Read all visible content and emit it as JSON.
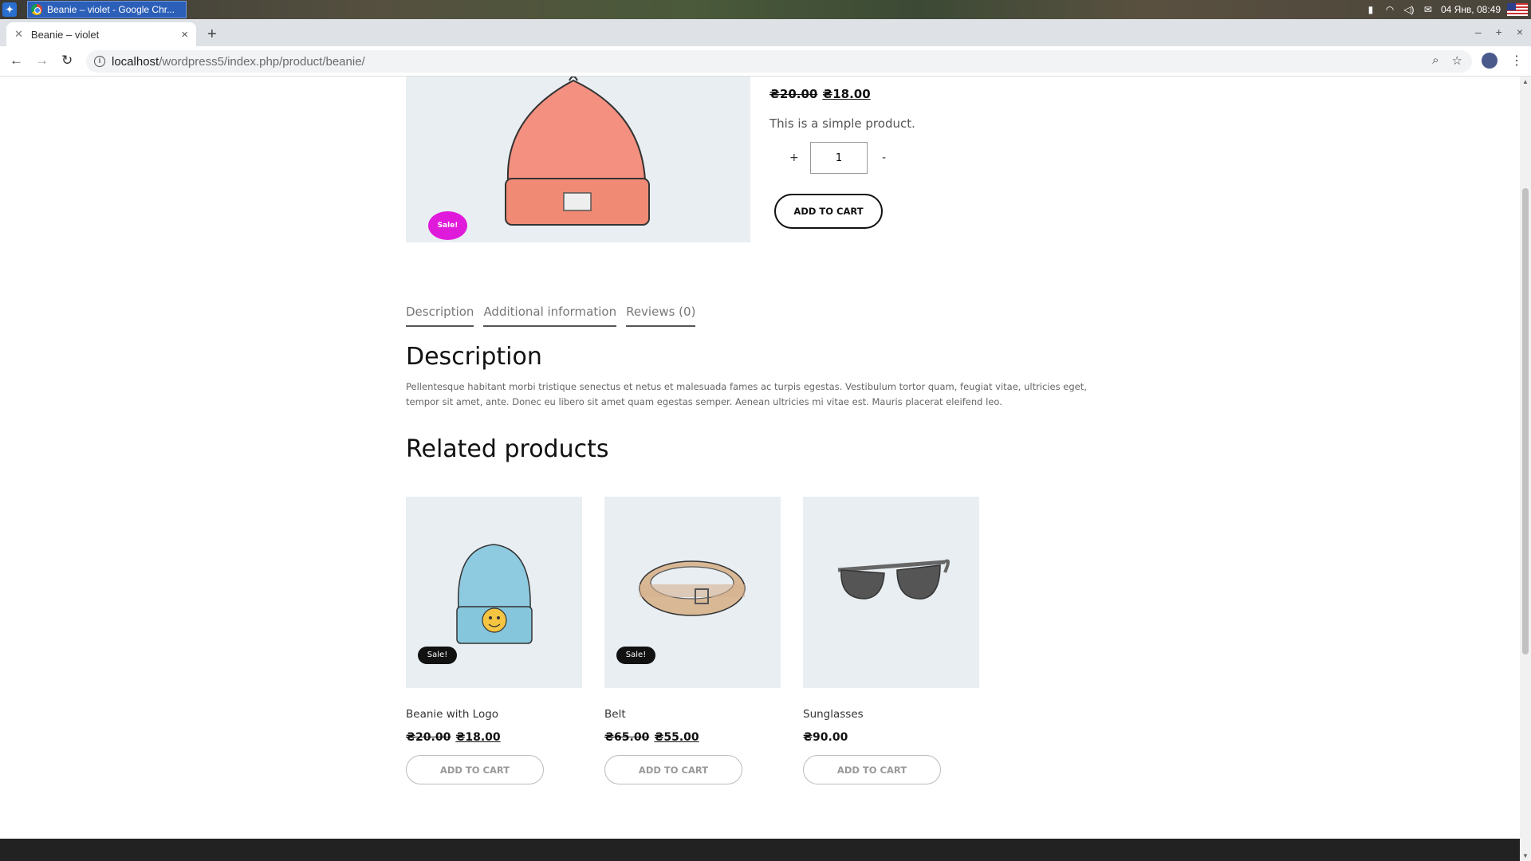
{
  "taskbar": {
    "app_label": "Beanie – violet - Google Chr...",
    "datetime": "04 Янв, 08:49"
  },
  "browser": {
    "tab_title": "Beanie – violet",
    "url_host": "localhost",
    "url_path": "/wordpress5/index.php/product/beanie/"
  },
  "product": {
    "old_price": "₴20.00",
    "new_price": "₴18.00",
    "short_description": "This is a simple product.",
    "qty_plus": "+",
    "quantity": "1",
    "qty_minus": "-",
    "add_to_cart": "ADD TO CART",
    "sale_badge": "Sale!",
    "image_color": "#f28b74"
  },
  "tabs": [
    {
      "label": "Description"
    },
    {
      "label": "Additional information"
    },
    {
      "label": "Reviews (0)"
    }
  ],
  "description": {
    "heading": "Description",
    "text": "Pellentesque habitant morbi tristique senectus et netus et malesuada fames ac turpis egestas. Vestibulum tortor quam, feugiat vitae, ultricies eget, tempor sit amet, ante. Donec eu libero sit amet quam egestas semper. Aenean ultricies mi vitae est. Mauris placerat eleifend leo."
  },
  "related": {
    "heading": "Related products",
    "items": [
      {
        "name": "Beanie with Logo",
        "old_price": "₴20.00",
        "price": "₴18.00",
        "sale": "Sale!",
        "button": "ADD TO CART"
      },
      {
        "name": "Belt",
        "old_price": "₴65.00",
        "price": "₴55.00",
        "sale": "Sale!",
        "button": "ADD TO CART"
      },
      {
        "name": "Sunglasses",
        "old_price": "",
        "price": "₴90.00",
        "sale": "",
        "button": "ADD TO CART"
      }
    ]
  },
  "colors": {
    "sale_main": "#e01adb",
    "sale_related": "#111111",
    "image_bg": "#e8eef2"
  }
}
